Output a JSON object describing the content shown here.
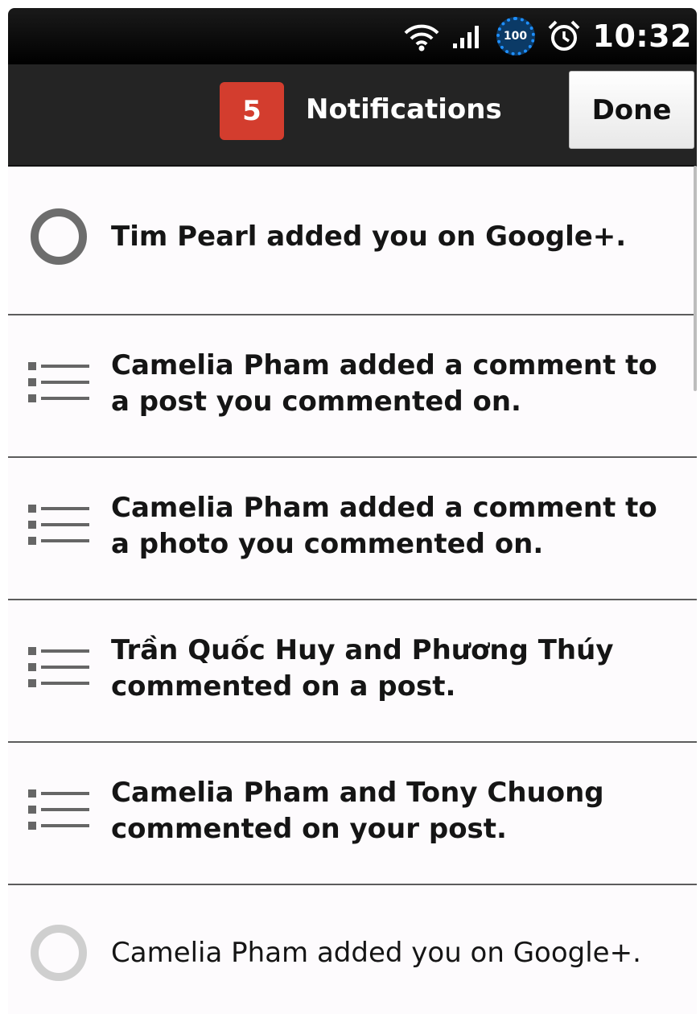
{
  "status_bar": {
    "time": "10:32",
    "battery_level": "100",
    "icons": [
      "wifi-icon",
      "signal-icon",
      "battery-icon",
      "alarm-icon"
    ]
  },
  "action_bar": {
    "badge_count": "5",
    "title": "Notifications",
    "done_label": "Done"
  },
  "notifications": [
    {
      "text": "Tim Pearl added you on Google+.",
      "icon": "circle-icon",
      "unread": true
    },
    {
      "text": "Camelia Pham added a comment to a post you commented on.",
      "icon": "list-icon",
      "unread": true
    },
    {
      "text": "Camelia Pham added a comment to a photo you commented on.",
      "icon": "list-icon",
      "unread": true
    },
    {
      "text": "Trần Quốc Huy and Phương Thúy commented on a post.",
      "icon": "list-icon",
      "unread": true
    },
    {
      "text": "Camelia Pham and Tony Chuong commented on your post.",
      "icon": "list-icon",
      "unread": true
    },
    {
      "text": "Camelia Pham added you on Google+.",
      "icon": "circle-icon",
      "unread": false
    }
  ],
  "colors": {
    "badge": "#d33d2e",
    "action_bar": "#242424",
    "list_bg": "#fdfbfd",
    "battery_ring": "#1e8fff"
  }
}
